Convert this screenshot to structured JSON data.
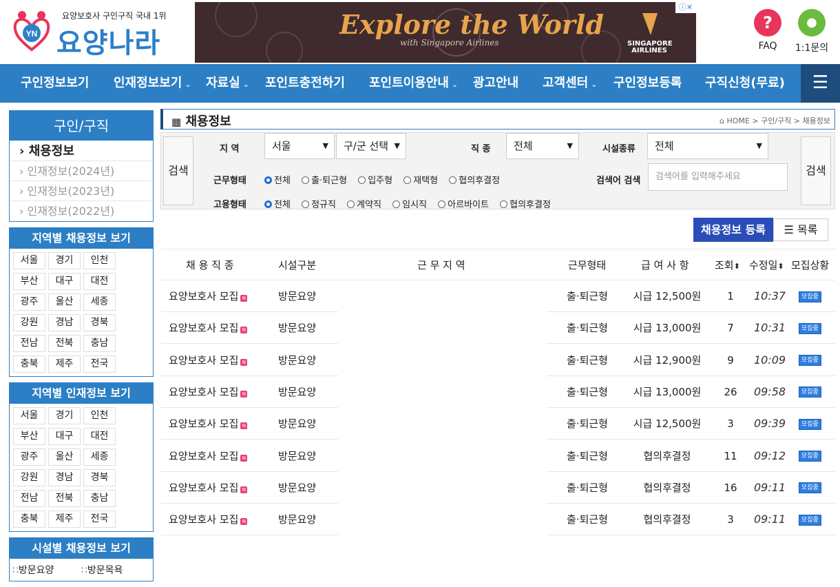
{
  "header": {
    "logo_tagline": "요양보호사 구인구직 국내 1위",
    "logo_badge": "YN",
    "logo_name": "요양나라",
    "ad": {
      "headline": "Explore the World",
      "sub": "with Singapore Airlines",
      "brand": "SINGAPORE AIRLINES",
      "close_icons": "ⓘ✕"
    },
    "faq": {
      "icon": "question-icon",
      "glyph": "?",
      "label": "FAQ",
      "color": "#e8355a"
    },
    "inquiry": {
      "icon": "chat-icon",
      "glyph": "●",
      "label": "1:1문의",
      "color": "#6bbb3e"
    }
  },
  "nav": {
    "items": [
      {
        "label": "구인정보보기",
        "arrow": ""
      },
      {
        "label": "인재정보보기",
        "arrow": "⌄"
      },
      {
        "label": "자료실",
        "arrow": "⌄"
      },
      {
        "label": "포인트충전하기",
        "arrow": ""
      },
      {
        "label": "포인트이용안내",
        "arrow": "⌄"
      },
      {
        "label": "광고안내",
        "arrow": ""
      },
      {
        "label": "고객센터",
        "arrow": "⌄"
      },
      {
        "label": "구인정보등록",
        "arrow": ""
      },
      {
        "label": "구직신청(무료)",
        "arrow": ""
      }
    ],
    "menu_glyph": "☰"
  },
  "sidebar": {
    "title": "구인/구직",
    "links": [
      "채용정보",
      "인재정보(2024년)",
      "인재정보(2023년)",
      "인재정보(2022년)"
    ],
    "region_jobs": {
      "title": "지역별 채용정보 보기",
      "regions": [
        "서울",
        "경기",
        "인천",
        "부산",
        "대구",
        "대전",
        "광주",
        "울산",
        "세종",
        "강원",
        "경남",
        "경북",
        "전남",
        "전북",
        "충남",
        "충북",
        "제주",
        "전국"
      ]
    },
    "region_talent": {
      "title": "지역별 인재정보 보기",
      "regions": [
        "서울",
        "경기",
        "인천",
        "부산",
        "대구",
        "대전",
        "광주",
        "울산",
        "세종",
        "강원",
        "경남",
        "경북",
        "전남",
        "전북",
        "충남",
        "충북",
        "제주",
        "전국"
      ]
    },
    "facility": {
      "title": "시설별 채용정보 보기",
      "items": [
        "방문요양",
        "방문목욕"
      ]
    }
  },
  "page": {
    "title": "채용정보",
    "breadcrumb": "HOME > 구인/구직 > 채용정보"
  },
  "search": {
    "button": "검색",
    "region_label": "지 역",
    "region_value": "서울",
    "district_value": "구/군 선택",
    "job_label": "직 종",
    "job_value": "전체",
    "facility_label": "시설종류",
    "facility_value": "전체",
    "worktype_label": "근무형태",
    "worktype_options": [
      "전체",
      "출·퇴근형",
      "입주형",
      "재택형",
      "협의후결정"
    ],
    "emp_label": "고용형태",
    "emp_options": [
      "전체",
      "정규직",
      "계약직",
      "임시직",
      "아르바이트",
      "협의후결정"
    ],
    "keyword_label": "검색어 검색",
    "keyword_placeholder": "검색어를 입력해주세요"
  },
  "actions": {
    "register": "채용정보 등록",
    "list": "목록"
  },
  "table": {
    "headers": [
      "채 용 직 종",
      "시설구분",
      "근 무 지 역",
      "근무형태",
      "급 여 사 항",
      "조회",
      "수정일",
      "모집상황"
    ],
    "rows": [
      {
        "job": "요양보호사 모집",
        "facility": "방문요양",
        "region": "",
        "worktype": "출·퇴근형",
        "pay": "시급 12,500원",
        "views": "1",
        "date": "10:37",
        "status": "모집중"
      },
      {
        "job": "요양보호사 모집",
        "facility": "방문요양",
        "region": "",
        "worktype": "출·퇴근형",
        "pay": "시급 13,000원",
        "views": "7",
        "date": "10:31",
        "status": "모집중"
      },
      {
        "job": "요양보호사 모집",
        "facility": "방문요양",
        "region": "",
        "worktype": "출·퇴근형",
        "pay": "시급 12,900원",
        "views": "9",
        "date": "10:09",
        "status": "모집중"
      },
      {
        "job": "요양보호사 모집",
        "facility": "방문요양",
        "region": "",
        "worktype": "출·퇴근형",
        "pay": "시급 13,000원",
        "views": "26",
        "date": "09:58",
        "status": "모집중"
      },
      {
        "job": "요양보호사 모집",
        "facility": "방문요양",
        "region": "",
        "worktype": "출·퇴근형",
        "pay": "시급 12,500원",
        "views": "3",
        "date": "09:39",
        "status": "모집중"
      },
      {
        "job": "요양보호사 모집",
        "facility": "방문요양",
        "region": "",
        "worktype": "출·퇴근형",
        "pay": "협의후결정",
        "views": "11",
        "date": "09:12",
        "status": "모집중"
      },
      {
        "job": "요양보호사 모집",
        "facility": "방문요양",
        "region": "",
        "worktype": "출·퇴근형",
        "pay": "협의후결정",
        "views": "16",
        "date": "09:11",
        "status": "모집중"
      },
      {
        "job": "요양보호사 모집",
        "facility": "방문요양",
        "region": "",
        "worktype": "출·퇴근형",
        "pay": "협의후결정",
        "views": "3",
        "date": "09:11",
        "status": "모집중"
      }
    ],
    "new_badge": "N"
  }
}
